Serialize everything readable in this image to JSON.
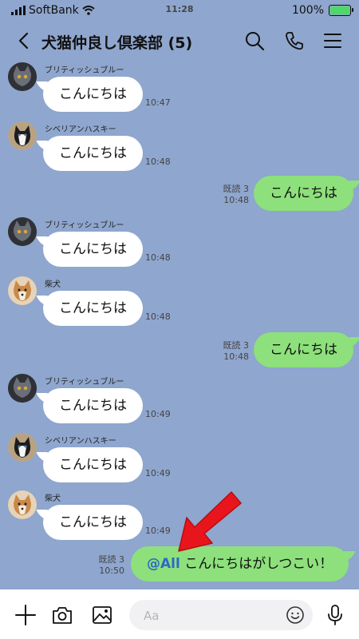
{
  "status_bar": {
    "carrier": "SoftBank",
    "time": "11:28",
    "battery": "100%"
  },
  "header": {
    "title": "犬猫仲良し倶楽部 (5)"
  },
  "messages": [
    {
      "sender": "ブリティッシュブルー",
      "text": "こんにちは",
      "time": "10:47"
    },
    {
      "sender": "シベリアンハスキー",
      "text": "こんにちは",
      "time": "10:48"
    },
    {
      "text": "こんにちは",
      "read": "既読 3",
      "time": "10:48"
    },
    {
      "sender": "ブリティッシュブルー",
      "text": "こんにちは",
      "time": "10:48"
    },
    {
      "sender": "柴犬",
      "text": "こんにちは",
      "time": "10:48"
    },
    {
      "text": "こんにちは",
      "read": "既読 3",
      "time": "10:48"
    },
    {
      "sender": "ブリティッシュブルー",
      "text": "こんにちは",
      "time": "10:49"
    },
    {
      "sender": "シベリアンハスキー",
      "text": "こんにちは",
      "time": "10:49"
    },
    {
      "sender": "柴犬",
      "text": "こんにちは",
      "time": "10:49"
    },
    {
      "mention": "@All",
      "text": "こんにちはがしつこい！",
      "read": "既読 3",
      "time": "10:50"
    }
  ],
  "composer": {
    "placeholder": "Aa"
  },
  "icons": {
    "back": "back-icon",
    "search": "search-icon",
    "call": "phone-icon",
    "menu": "menu-icon",
    "plus": "plus-icon",
    "camera": "camera-icon",
    "image": "image-icon",
    "emoji": "emoji-icon",
    "mic": "microphone-icon",
    "arrow": "red-arrow-icon"
  },
  "colors": {
    "background": "#8fa6ce",
    "outgoing_bubble": "#8de07b",
    "incoming_bubble": "#ffffff",
    "mention": "#2d68c8",
    "arrow": "#e8161c"
  }
}
